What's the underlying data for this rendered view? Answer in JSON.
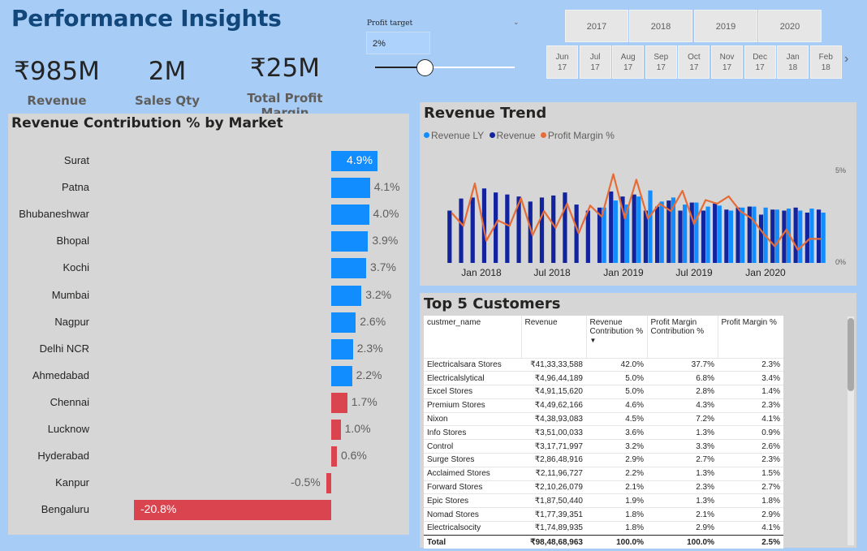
{
  "header": {
    "title": "Performance Insights"
  },
  "kpis": [
    {
      "value": "₹985M",
      "label": "Revenue"
    },
    {
      "value": "2M",
      "label": "Sales Qty"
    },
    {
      "value": "₹25M",
      "label": "Total Profit Margin"
    }
  ],
  "profit_target": {
    "title": "Profit target",
    "value": "2%",
    "slider_fraction": 0.36
  },
  "years": [
    "2017",
    "2018",
    "2019",
    "2020"
  ],
  "months": [
    {
      "m": "Jun",
      "y": "17"
    },
    {
      "m": "Jul",
      "y": "17"
    },
    {
      "m": "Aug",
      "y": "17"
    },
    {
      "m": "Sep",
      "y": "17"
    },
    {
      "m": "Oct",
      "y": "17"
    },
    {
      "m": "Nov",
      "y": "17"
    },
    {
      "m": "Dec",
      "y": "17"
    },
    {
      "m": "Jan",
      "y": "18"
    },
    {
      "m": "Feb",
      "y": "18"
    }
  ],
  "month_next_icon": "chevron-right-icon",
  "market_chart": {
    "title": "Revenue Contribution % by Market",
    "colors": {
      "positive": "#118dff",
      "negative": "#d9444f"
    },
    "rows": [
      {
        "market": "Surat",
        "value": 4.9,
        "label": "4.9%"
      },
      {
        "market": "Patna",
        "value": 4.1,
        "label": "4.1%"
      },
      {
        "market": "Bhubaneshwar",
        "value": 4.0,
        "label": "4.0%"
      },
      {
        "market": "Bhopal",
        "value": 3.9,
        "label": "3.9%"
      },
      {
        "market": "Kochi",
        "value": 3.7,
        "label": "3.7%"
      },
      {
        "market": "Mumbai",
        "value": 3.2,
        "label": "3.2%"
      },
      {
        "market": "Nagpur",
        "value": 2.6,
        "label": "2.6%"
      },
      {
        "market": "Delhi NCR",
        "value": 2.3,
        "label": "2.3%"
      },
      {
        "market": "Ahmedabad",
        "value": 2.2,
        "label": "2.2%"
      },
      {
        "market": "Chennai",
        "value": 1.7,
        "label": "1.7%"
      },
      {
        "market": "Lucknow",
        "value": 1.0,
        "label": "1.0%"
      },
      {
        "market": "Hyderabad",
        "value": 0.6,
        "label": "0.6%"
      },
      {
        "market": "Kanpur",
        "value": -0.5,
        "label": "-0.5%"
      },
      {
        "market": "Bengaluru",
        "value": -20.8,
        "label": "-20.8%"
      }
    ]
  },
  "trend": {
    "title": "Revenue Trend",
    "legend": [
      {
        "name": "Revenue LY",
        "color": "#118dff"
      },
      {
        "name": "Revenue",
        "color": "#12239e"
      },
      {
        "name": "Profit Margin %",
        "color": "#e66c37"
      }
    ],
    "x_labels": [
      "Jan 2018",
      "Jul 2018",
      "Jan 2019",
      "Jul 2019",
      "Jan 2020"
    ],
    "y_labels": [
      "5%",
      "0%"
    ]
  },
  "chart_data": {
    "type": "bar",
    "x": [
      "2017-10",
      "2017-11",
      "2017-12",
      "2018-01",
      "2018-02",
      "2018-03",
      "2018-04",
      "2018-05",
      "2018-06",
      "2018-07",
      "2018-08",
      "2018-09",
      "2018-10",
      "2018-11",
      "2018-12",
      "2019-01",
      "2019-02",
      "2019-03",
      "2019-04",
      "2019-05",
      "2019-06",
      "2019-07",
      "2019-08",
      "2019-09",
      "2019-10",
      "2019-11",
      "2019-12",
      "2020-01",
      "2020-02",
      "2020-03",
      "2020-04",
      "2020-05",
      "2020-06"
    ],
    "series": [
      {
        "name": "Revenue LY",
        "values": [
          null,
          null,
          null,
          null,
          null,
          null,
          null,
          null,
          null,
          null,
          null,
          null,
          null,
          0.55,
          0.62,
          0.58,
          0.66,
          0.72,
          0.61,
          0.65,
          0.58,
          0.6,
          0.56,
          0.57,
          0.52,
          0.55,
          0.56,
          0.55,
          0.53,
          0.54,
          0.52,
          0.54,
          0.5
        ]
      },
      {
        "name": "Revenue",
        "values": [
          0.52,
          0.64,
          0.65,
          0.74,
          0.7,
          0.68,
          0.66,
          0.61,
          0.65,
          0.67,
          0.7,
          0.58,
          0.52,
          0.55,
          0.71,
          0.66,
          0.68,
          0.52,
          0.56,
          0.62,
          0.52,
          0.6,
          0.52,
          0.59,
          0.53,
          0.55,
          0.56,
          0.48,
          0.53,
          0.52,
          0.55,
          0.5,
          0.53
        ]
      },
      {
        "name": "Profit Margin %",
        "values": [
          2.7,
          2.0,
          4.3,
          1.2,
          2.3,
          2.0,
          3.5,
          1.5,
          2.8,
          1.9,
          3.2,
          1.6,
          3.1,
          2.5,
          4.8,
          2.4,
          4.5,
          2.4,
          3.2,
          2.8,
          3.9,
          2.1,
          3.4,
          3.2,
          3.6,
          2.8,
          2.4,
          1.6,
          0.9,
          1.8,
          0.7,
          1.3,
          1.3
        ]
      }
    ],
    "ylim": [
      0,
      5
    ]
  },
  "customers": {
    "title": "Top 5 Customers",
    "columns": [
      "custmer_name",
      "Revenue",
      "Revenue Contribution %",
      "Profit Margin Contribution %",
      "Profit Margin %"
    ],
    "sort_icon": "sort-down-icon",
    "rows": [
      [
        "Electricalsara Stores",
        "₹41,33,33,588",
        "42.0%",
        "37.7%",
        "2.3%"
      ],
      [
        "Electricalslytical",
        "₹4,96,44,189",
        "5.0%",
        "6.8%",
        "3.4%"
      ],
      [
        "Excel Stores",
        "₹4,91,15,620",
        "5.0%",
        "2.8%",
        "1.4%"
      ],
      [
        "Premium Stores",
        "₹4,49,62,166",
        "4.6%",
        "4.3%",
        "2.3%"
      ],
      [
        "Nixon",
        "₹4,38,93,083",
        "4.5%",
        "7.2%",
        "4.1%"
      ],
      [
        "Info Stores",
        "₹3,51,00,033",
        "3.6%",
        "1.3%",
        "0.9%"
      ],
      [
        "Control",
        "₹3,17,71,997",
        "3.2%",
        "3.3%",
        "2.6%"
      ],
      [
        "Surge Stores",
        "₹2,86,48,916",
        "2.9%",
        "2.7%",
        "2.3%"
      ],
      [
        "Acclaimed Stores",
        "₹2,11,96,727",
        "2.2%",
        "1.3%",
        "1.5%"
      ],
      [
        "Forward Stores",
        "₹2,10,26,079",
        "2.1%",
        "2.3%",
        "2.7%"
      ],
      [
        "Epic Stores",
        "₹1,87,50,440",
        "1.9%",
        "1.3%",
        "1.8%"
      ],
      [
        "Nomad Stores",
        "₹1,77,39,351",
        "1.8%",
        "2.1%",
        "2.9%"
      ],
      [
        "Electricalsocity",
        "₹1,74,89,935",
        "1.8%",
        "2.9%",
        "4.1%"
      ]
    ],
    "total": [
      "Total",
      "₹98,48,68,963",
      "100.0%",
      "100.0%",
      "2.5%"
    ]
  }
}
